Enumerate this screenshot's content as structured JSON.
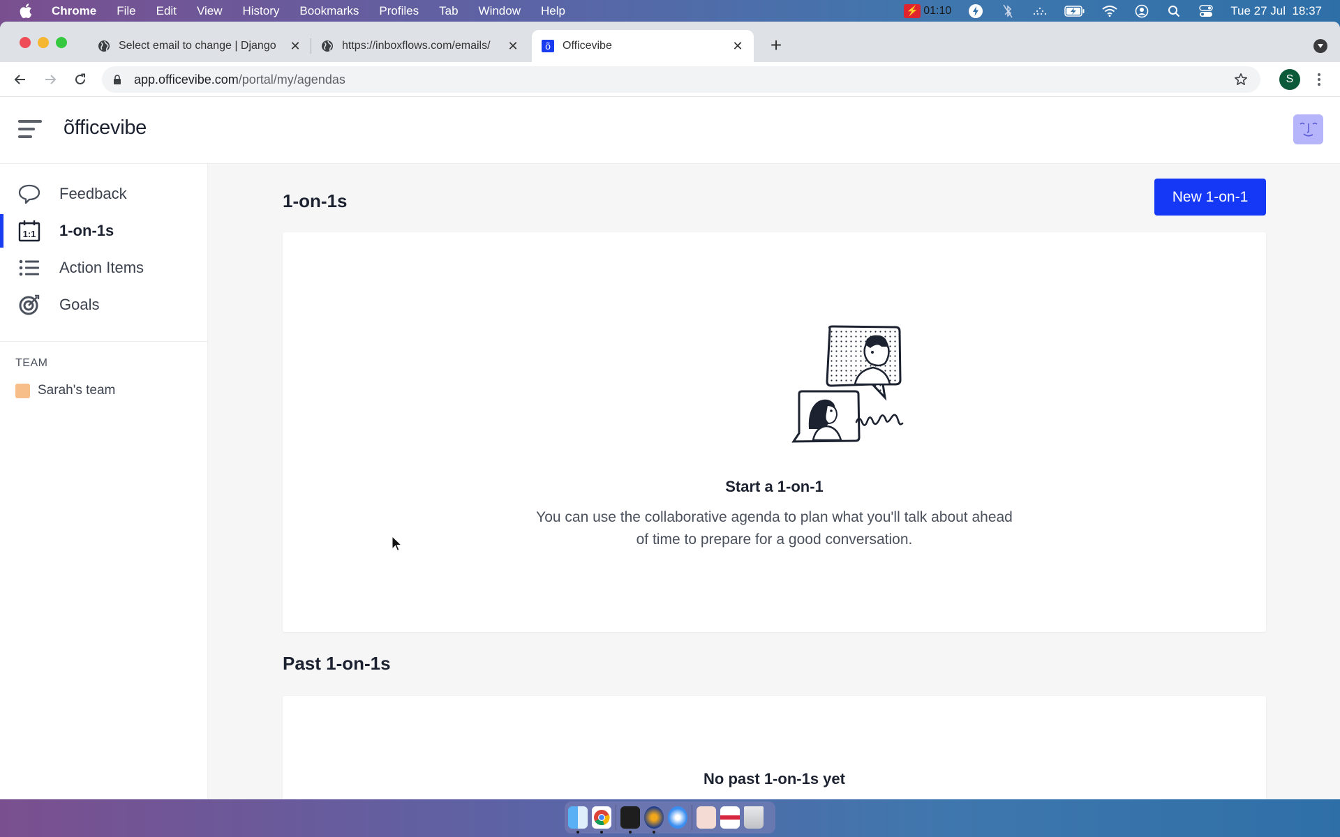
{
  "menubar": {
    "app_name": "Chrome",
    "items": [
      "File",
      "Edit",
      "View",
      "History",
      "Bookmarks",
      "Profiles",
      "Tab",
      "Window",
      "Help"
    ],
    "recording_time": "01:10",
    "datetime": "Tue 27 Jul  18:37"
  },
  "browser": {
    "tabs": [
      {
        "title": "Select email to change | Django",
        "favicon": "globe-icon",
        "active": false
      },
      {
        "title": "https://inboxflows.com/emails/",
        "favicon": "globe-icon",
        "active": false
      },
      {
        "title": "Officevibe",
        "favicon": "officevibe-icon",
        "active": true
      }
    ],
    "url_host": "app.officevibe.com",
    "url_path": "/portal/my/agendas",
    "profile_initial": "S"
  },
  "app": {
    "logo": "õfficevibe",
    "sidebar": {
      "items": [
        {
          "label": "Feedback",
          "icon": "speech-bubble-icon",
          "active": false
        },
        {
          "label": "1-on-1s",
          "icon": "calendar-1-1-icon",
          "active": true
        },
        {
          "label": "Action Items",
          "icon": "list-icon",
          "active": false
        },
        {
          "label": "Goals",
          "icon": "target-icon",
          "active": false
        }
      ],
      "team_heading": "TEAM",
      "teams": [
        {
          "name": "Sarah's team",
          "color": "#f7be8a"
        }
      ]
    },
    "main": {
      "title": "1-on-1s",
      "new_button": "New 1-on-1",
      "empty_state": {
        "title": "Start a 1-on-1",
        "description_line1": "You can use the collaborative agenda to plan what you'll talk about ahead",
        "description_line2": "of time to prepare for a good conversation."
      },
      "past_title": "Past 1-on-1s",
      "past_empty": "No past 1-on-1s yet"
    },
    "colors": {
      "accent": "#1438f5",
      "avatar_bg": "#b6b5fb"
    }
  },
  "dock": {
    "apps": [
      "Finder",
      "Chrome",
      "Terminal",
      "Lightning App",
      "Safari",
      "Document Preview",
      "Screenshot",
      "Trash"
    ]
  }
}
